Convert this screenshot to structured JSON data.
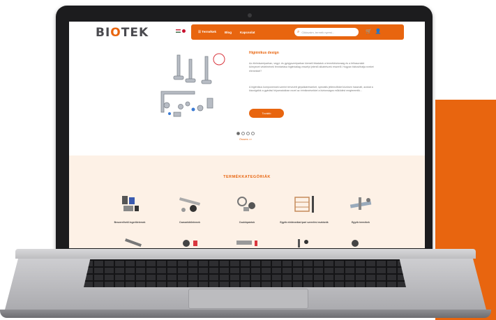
{
  "site": {
    "logo_text": "BIOTEK",
    "nav": {
      "products": "Termékek",
      "blog": "Blog",
      "contact": "Kapcsolat",
      "search_placeholder": "Cikkszám, termék nyersi...",
      "icons": [
        "search-icon",
        "cart-icon",
        "user-icon"
      ]
    },
    "hero": {
      "title": "Higiénikus design",
      "paragraph1": "Az élelmiszeriparban, vegyi- és gyógyszeriparban kiemelt feladatok a termékbiztonság és a felhasználói környezet védelmének fenntartása higiéniailag veszélyt jelentő alkatrészek részéről. Hogyan biztosíthatja ezeket elemekkel?",
      "paragraph2": "A higiénikus komponensek szerint tervezett gépalkatrészeket, speciális jellemzőkkel közösen használt, azokat a kiszolgálók a gyártási folyamatokban ezzel az érintkezésekkel a biztonságos működést megteremtik...",
      "button": "Tovább",
      "carousel_total": 4,
      "carousel_active": 1,
      "all_link": "Összes >>"
    },
    "categories": {
      "title": "TERMÉKKATEGÓRIÁK",
      "items": [
        {
          "label": "Beszerelhető ingerlőelemek"
        },
        {
          "label": "Csavarkötőelemek"
        },
        {
          "label": "Csuklópántok"
        },
        {
          "label": "Egyéb elektronikai ipari szerelési eszközök"
        },
        {
          "label": "Egyéb termékek"
        }
      ]
    },
    "colors": {
      "accent": "#e8650f",
      "cat_bg": "#fdf1e6"
    }
  }
}
